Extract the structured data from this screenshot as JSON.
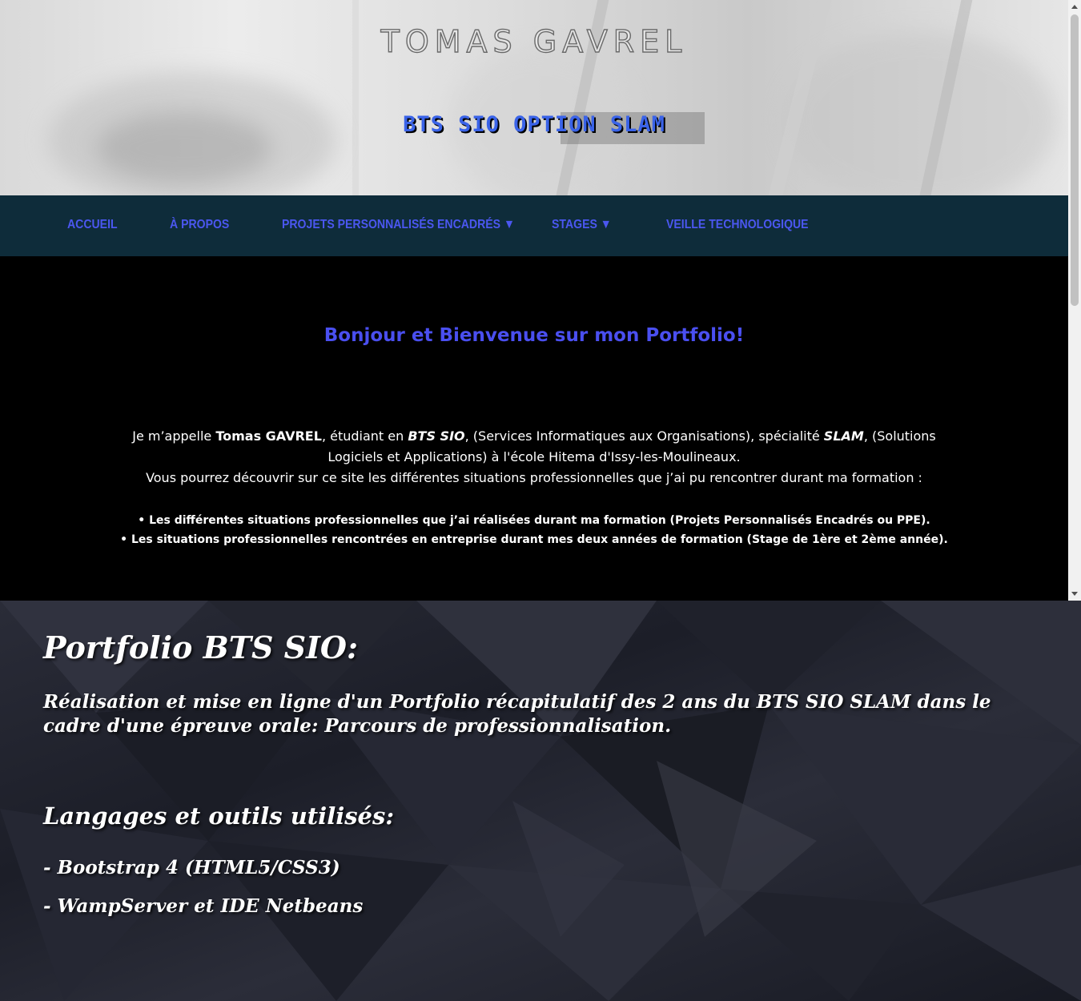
{
  "header": {
    "title": "TOMAS GAVREL",
    "subtitle": "BTS SIO OPTION SLAM"
  },
  "nav": {
    "items": [
      {
        "label": "ACCUEIL"
      },
      {
        "label": "À PROPOS"
      },
      {
        "label": "PROJETS PERSONNALISÉS ENCADRÉS ▼"
      },
      {
        "label": "STAGES ▼"
      },
      {
        "label": "VEILLE TECHNOLOGIQUE"
      }
    ]
  },
  "welcome": {
    "title": "Bonjour et Bienvenue sur mon Portfolio!",
    "intro": {
      "p1": "Je m’appelle ",
      "name": "Tomas GAVREL",
      "p2": ",  étudiant en ",
      "bts": "BTS SIO",
      "p3": ", (Services Informatiques aux Organisations), spécialité ",
      "slam": "SLAM",
      "p4": ", (Solutions Logiciels et Applications) à l'école Hitema d'Issy-les-Moulineaux.",
      "p5": "Vous pourrez découvrir sur ce site les différentes situations professionnelles que j’ai pu rencontrer durant ma formation :"
    },
    "bullets": [
      "• Les différentes situations professionnelles que j’ai réalisées durant ma formation (Projets Personnalisés Encadrés ou PPE).",
      "• Les situations professionnelles rencontrées en entreprise durant mes deux années de formation (Stage de 1ère et 2ème année)."
    ]
  },
  "portfolio": {
    "title": "Portfolio BTS SIO:",
    "description": "Réalisation et mise en ligne d'un Portfolio récapitulatif des 2 ans du BTS SIO SLAM dans le cadre d'une épreuve orale: Parcours de professionnalisation.",
    "tools_heading": "Langages et outils utilisés:",
    "tools": [
      "- Bootstrap 4 (HTML5/CSS3)",
      "- WampServer et IDE Netbeans"
    ]
  },
  "colors": {
    "nav_bg": "#0e2c3a",
    "nav_link": "#4b57f0",
    "welcome_title": "#4a4ff0",
    "subtitle": "#3a63e8"
  }
}
